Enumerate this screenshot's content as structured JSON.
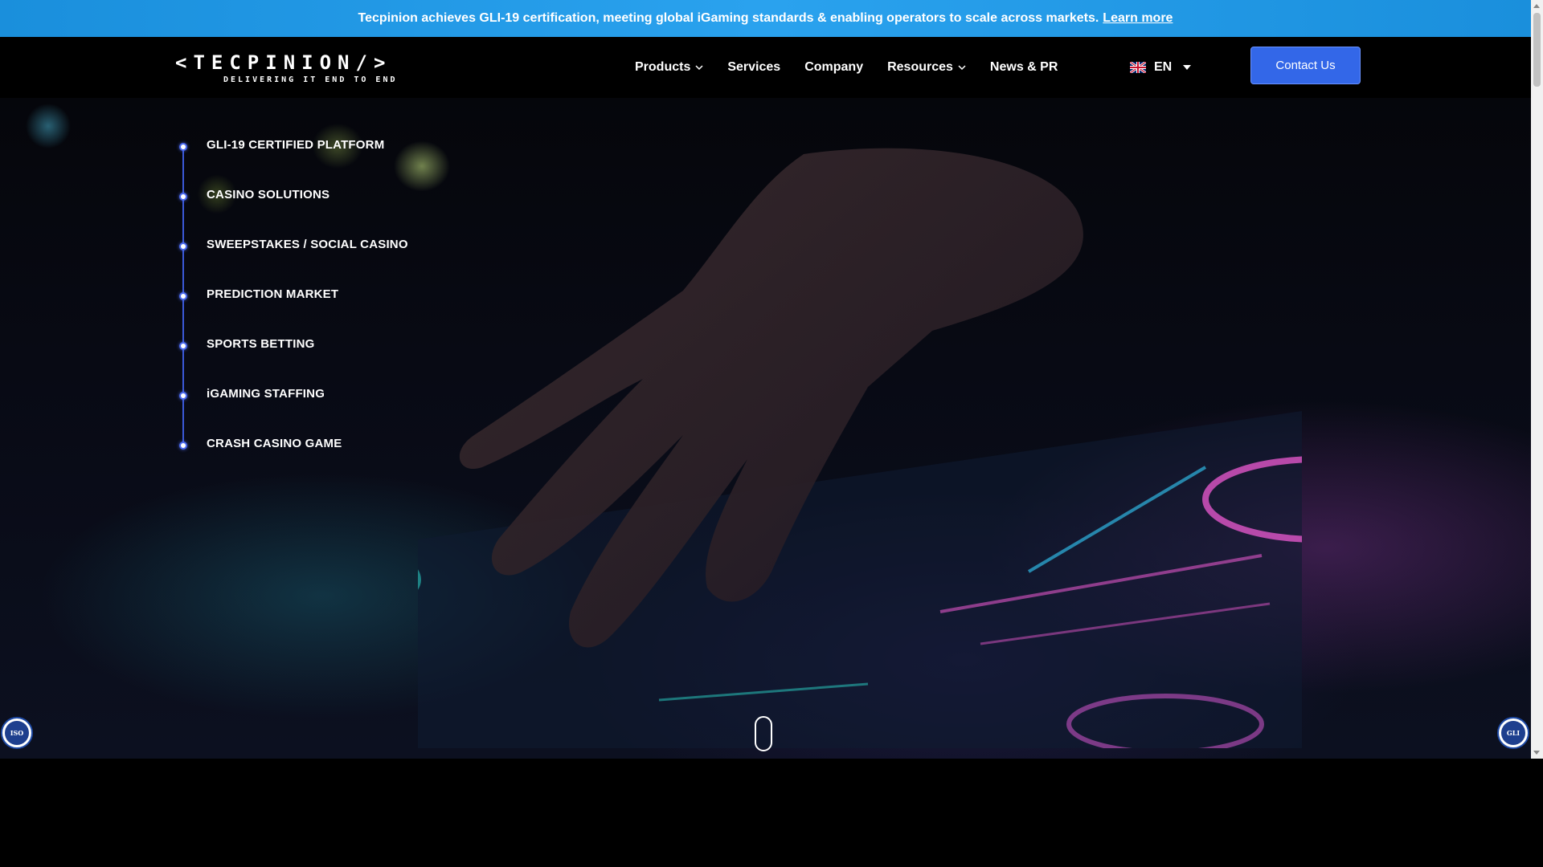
{
  "announcement": {
    "text": "Tecpinion achieves GLI-19 certification, meeting global iGaming standards & enabling operators to scale across markets.",
    "link_label": "Learn more"
  },
  "header": {
    "logo_text": "<TECPINION/>",
    "logo_tagline": "DELIVERING IT END TO END",
    "nav": [
      {
        "label": "Products",
        "has_dropdown": true
      },
      {
        "label": "Services",
        "has_dropdown": false
      },
      {
        "label": "Company",
        "has_dropdown": false
      },
      {
        "label": "Resources",
        "has_dropdown": true
      },
      {
        "label": "News & PR",
        "has_dropdown": false
      }
    ],
    "language": "EN",
    "contact_label": "Contact Us"
  },
  "hero": {
    "items": [
      {
        "label": "GLI-19 CERTIFIED PLATFORM"
      },
      {
        "label": "CASINO SOLUTIONS"
      },
      {
        "label": "SWEEPSTAKES / SOCIAL CASINO"
      },
      {
        "label": "PREDICTION MARKET"
      },
      {
        "label": "SPORTS BETTING"
      },
      {
        "label": "iGAMING STAFFING"
      },
      {
        "label": "CRASH CASINO GAME"
      }
    ]
  },
  "badges": {
    "left": "ISO",
    "right": "GLI"
  },
  "colors": {
    "announcement_bg": "#1a8fdc",
    "contact_button": "#3367e8",
    "timeline_accent": "#3b59d8"
  }
}
